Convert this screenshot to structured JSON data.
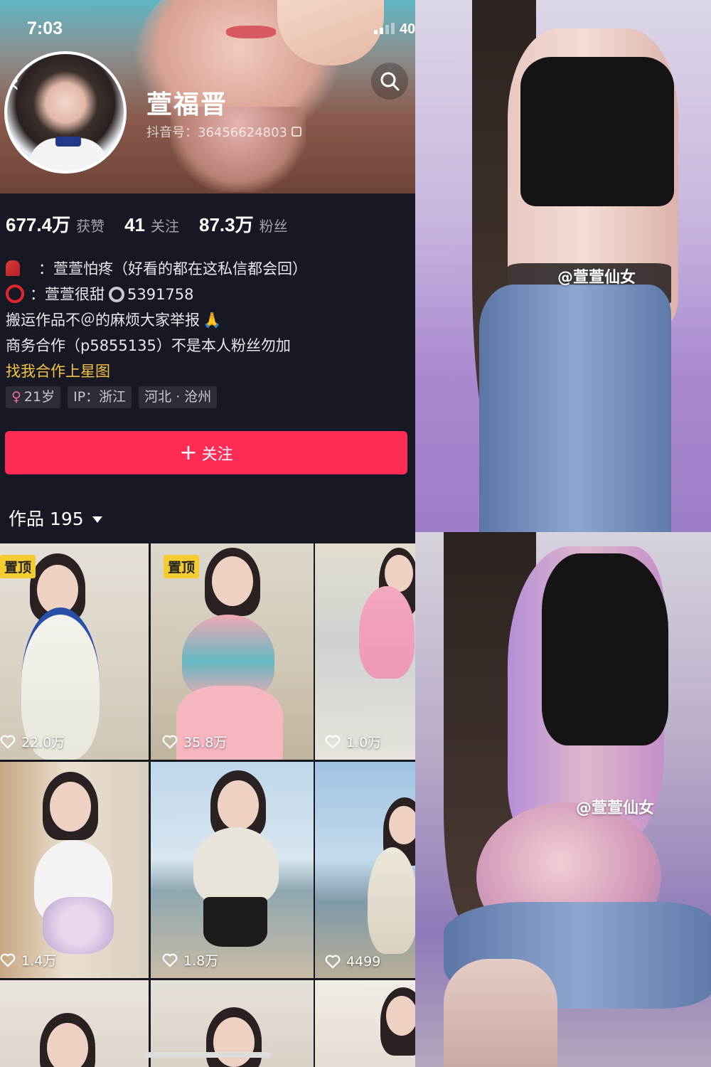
{
  "status_bar": {
    "time": "7:03",
    "battery": "40"
  },
  "profile": {
    "name": "萱福晋",
    "douyin_id": "抖音号：36456624803"
  },
  "stats": [
    {
      "value": "677.4万",
      "label": "获赞"
    },
    {
      "value": "41",
      "label": "关注"
    },
    {
      "value": "87.3万",
      "label": "粉丝"
    }
  ],
  "bio": {
    "line1": "：萱萱怕疼（好看的都在这私信都会回）",
    "line2_prefix": "：萱萱很甜",
    "line2_number": "5391758",
    "line3": "搬运作品不＠的麻烦大家举报",
    "line4": "商务合作（p5855135）不是本人粉丝勿加",
    "link": "找我合作上星图"
  },
  "tags": {
    "age": "21岁",
    "ip": "IP：浙江",
    "location": "河北 · 沧州"
  },
  "follow_button": {
    "label": "关注"
  },
  "works_tab": {
    "label": "作品 195"
  },
  "grid": {
    "pinned_label": "置顶",
    "videos": [
      {
        "likes": "22.0万",
        "pinned": true
      },
      {
        "likes": "35.8万",
        "pinned": true
      },
      {
        "likes": "1.0万",
        "pinned": false
      },
      {
        "likes": "1.4万",
        "pinned": false
      },
      {
        "likes": "1.8万",
        "pinned": false
      },
      {
        "likes": "4499",
        "pinned": false
      }
    ]
  },
  "photos": {
    "watermark_top": "@萱萱仙女",
    "watermark_bottom": "@萱萱仙女"
  },
  "colors": {
    "background": "#161823",
    "follow": "#fe2c55",
    "pinned": "#f5cc2f",
    "link": "#f7c244"
  }
}
